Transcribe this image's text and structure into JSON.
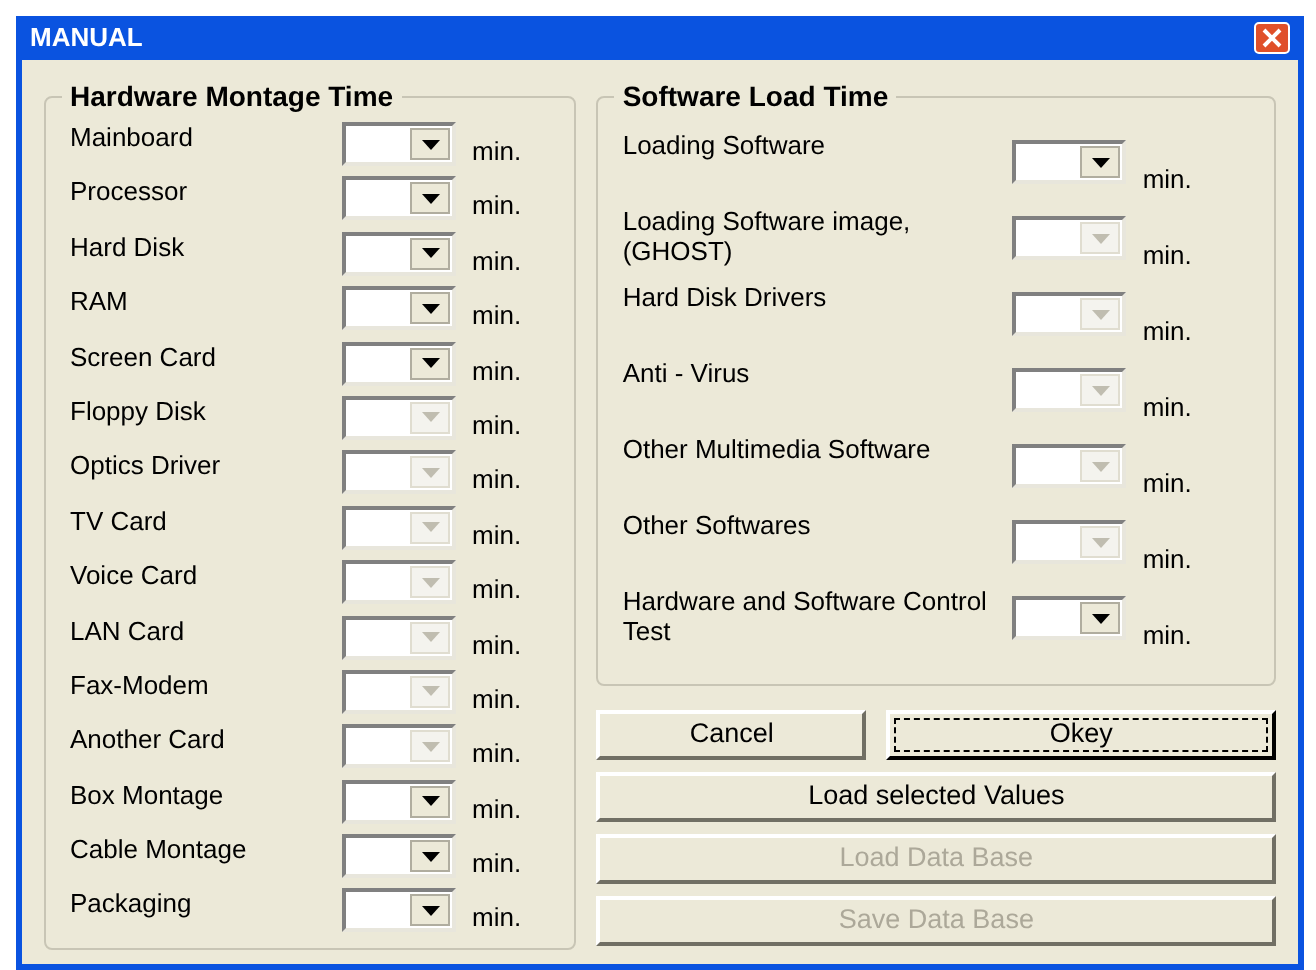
{
  "window": {
    "title": "MANUAL"
  },
  "hardware": {
    "title": "Hardware Montage Time",
    "rows": [
      {
        "label": "Mainboard",
        "unit": "min.",
        "disabled": false
      },
      {
        "label": "Processor",
        "unit": "min.",
        "disabled": false
      },
      {
        "label": "Hard Disk",
        "unit": "min.",
        "disabled": false
      },
      {
        "label": "RAM",
        "unit": "min.",
        "disabled": false
      },
      {
        "label": "Screen Card",
        "unit": "min.",
        "disabled": false
      },
      {
        "label": "Floppy Disk",
        "unit": "min.",
        "disabled": true
      },
      {
        "label": "Optics Driver",
        "unit": "min.",
        "disabled": true
      },
      {
        "label": "TV Card",
        "unit": "min.",
        "disabled": true
      },
      {
        "label": "Voice Card",
        "unit": "min.",
        "disabled": true
      },
      {
        "label": "LAN Card",
        "unit": "min.",
        "disabled": true
      },
      {
        "label": "Fax-Modem",
        "unit": "min.",
        "disabled": true
      },
      {
        "label": "Another Card",
        "unit": "min.",
        "disabled": true
      },
      {
        "label": "Box Montage",
        "unit": "min.",
        "disabled": false
      },
      {
        "label": "Cable Montage",
        "unit": "min.",
        "disabled": false
      },
      {
        "label": "Packaging",
        "unit": "min.",
        "disabled": false
      }
    ]
  },
  "software": {
    "title": "Software Load Time",
    "rows": [
      {
        "label": "Loading Software",
        "unit": "min.",
        "disabled": false
      },
      {
        "label": "Loading Software image, (GHOST)",
        "unit": "min.",
        "disabled": true
      },
      {
        "label": "Hard Disk Drivers",
        "unit": "min.",
        "disabled": true
      },
      {
        "label": "Anti - Virus",
        "unit": "min.",
        "disabled": true
      },
      {
        "label": "Other Multimedia Software",
        "unit": "min.",
        "disabled": true
      },
      {
        "label": "Other Softwares",
        "unit": "min.",
        "disabled": true
      },
      {
        "label": "Hardware and Software Control Test",
        "unit": "min.",
        "disabled": false
      }
    ]
  },
  "buttons": [
    {
      "label": "Cancel",
      "disabled": false,
      "default": false
    },
    {
      "label": "Okey",
      "disabled": false,
      "default": true
    },
    {
      "label": "Load selected Values",
      "disabled": false,
      "default": false
    },
    {
      "label": "Load Data Base",
      "disabled": true,
      "default": false
    },
    {
      "label": "Save Data Base",
      "disabled": true,
      "default": false
    }
  ]
}
